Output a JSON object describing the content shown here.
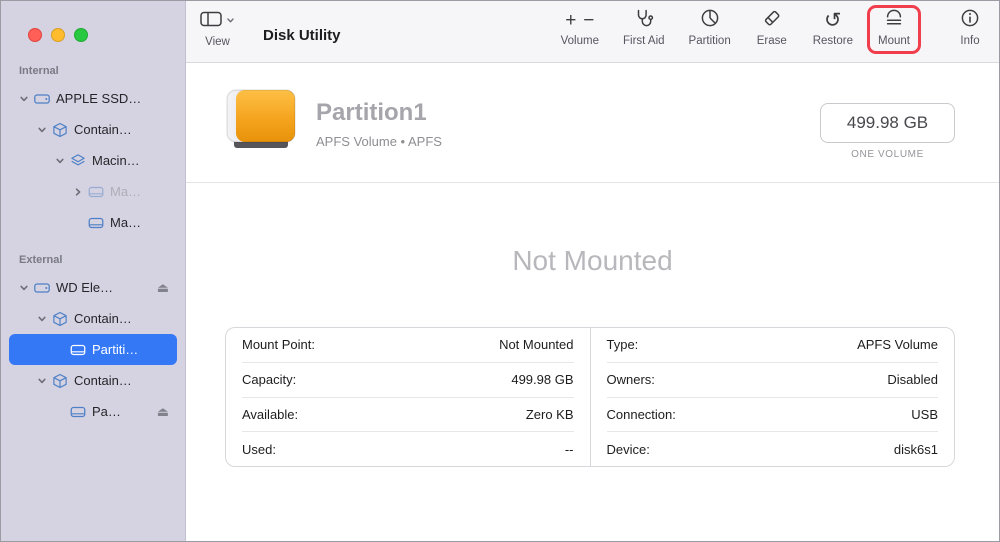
{
  "window": {
    "title": "Disk Utility"
  },
  "toolbar": {
    "view": "View",
    "volume": "Volume",
    "first_aid": "First Aid",
    "partition": "Partition",
    "erase": "Erase",
    "restore": "Restore",
    "mount": "Mount",
    "info": "Info"
  },
  "icons": {
    "plus": "+",
    "minus": "−",
    "restore": "↺",
    "eject": "⏏"
  },
  "sidebar": {
    "internal_header": "Internal",
    "external_header": "External",
    "items": [
      {
        "label": "APPLE SSD…"
      },
      {
        "label": "Contain…"
      },
      {
        "label": "Macin…"
      },
      {
        "label": "Ma…"
      },
      {
        "label": "Ma…"
      },
      {
        "label": "WD Ele…"
      },
      {
        "label": "Contain…"
      },
      {
        "label": "Partiti…"
      },
      {
        "label": "Contain…"
      },
      {
        "label": "Pa…"
      }
    ]
  },
  "main": {
    "volume_name": "Partition1",
    "volume_meta": "APFS Volume • APFS",
    "size": "499.98 GB",
    "size_caption": "ONE VOLUME",
    "status": "Not Mounted",
    "details_left": [
      {
        "label": "Mount Point:",
        "value": "Not Mounted"
      },
      {
        "label": "Capacity:",
        "value": "499.98 GB"
      },
      {
        "label": "Available:",
        "value": "Zero KB"
      },
      {
        "label": "Used:",
        "value": "--"
      }
    ],
    "details_right": [
      {
        "label": "Type:",
        "value": "APFS Volume"
      },
      {
        "label": "Owners:",
        "value": "Disabled"
      },
      {
        "label": "Connection:",
        "value": "USB"
      },
      {
        "label": "Device:",
        "value": "disk6s1"
      }
    ]
  },
  "colors": {
    "selection": "#3478f6",
    "annotation": "#f03e4d",
    "drive_orange": "#f5a41f",
    "sidebar_bg": "#d5d2e1"
  }
}
